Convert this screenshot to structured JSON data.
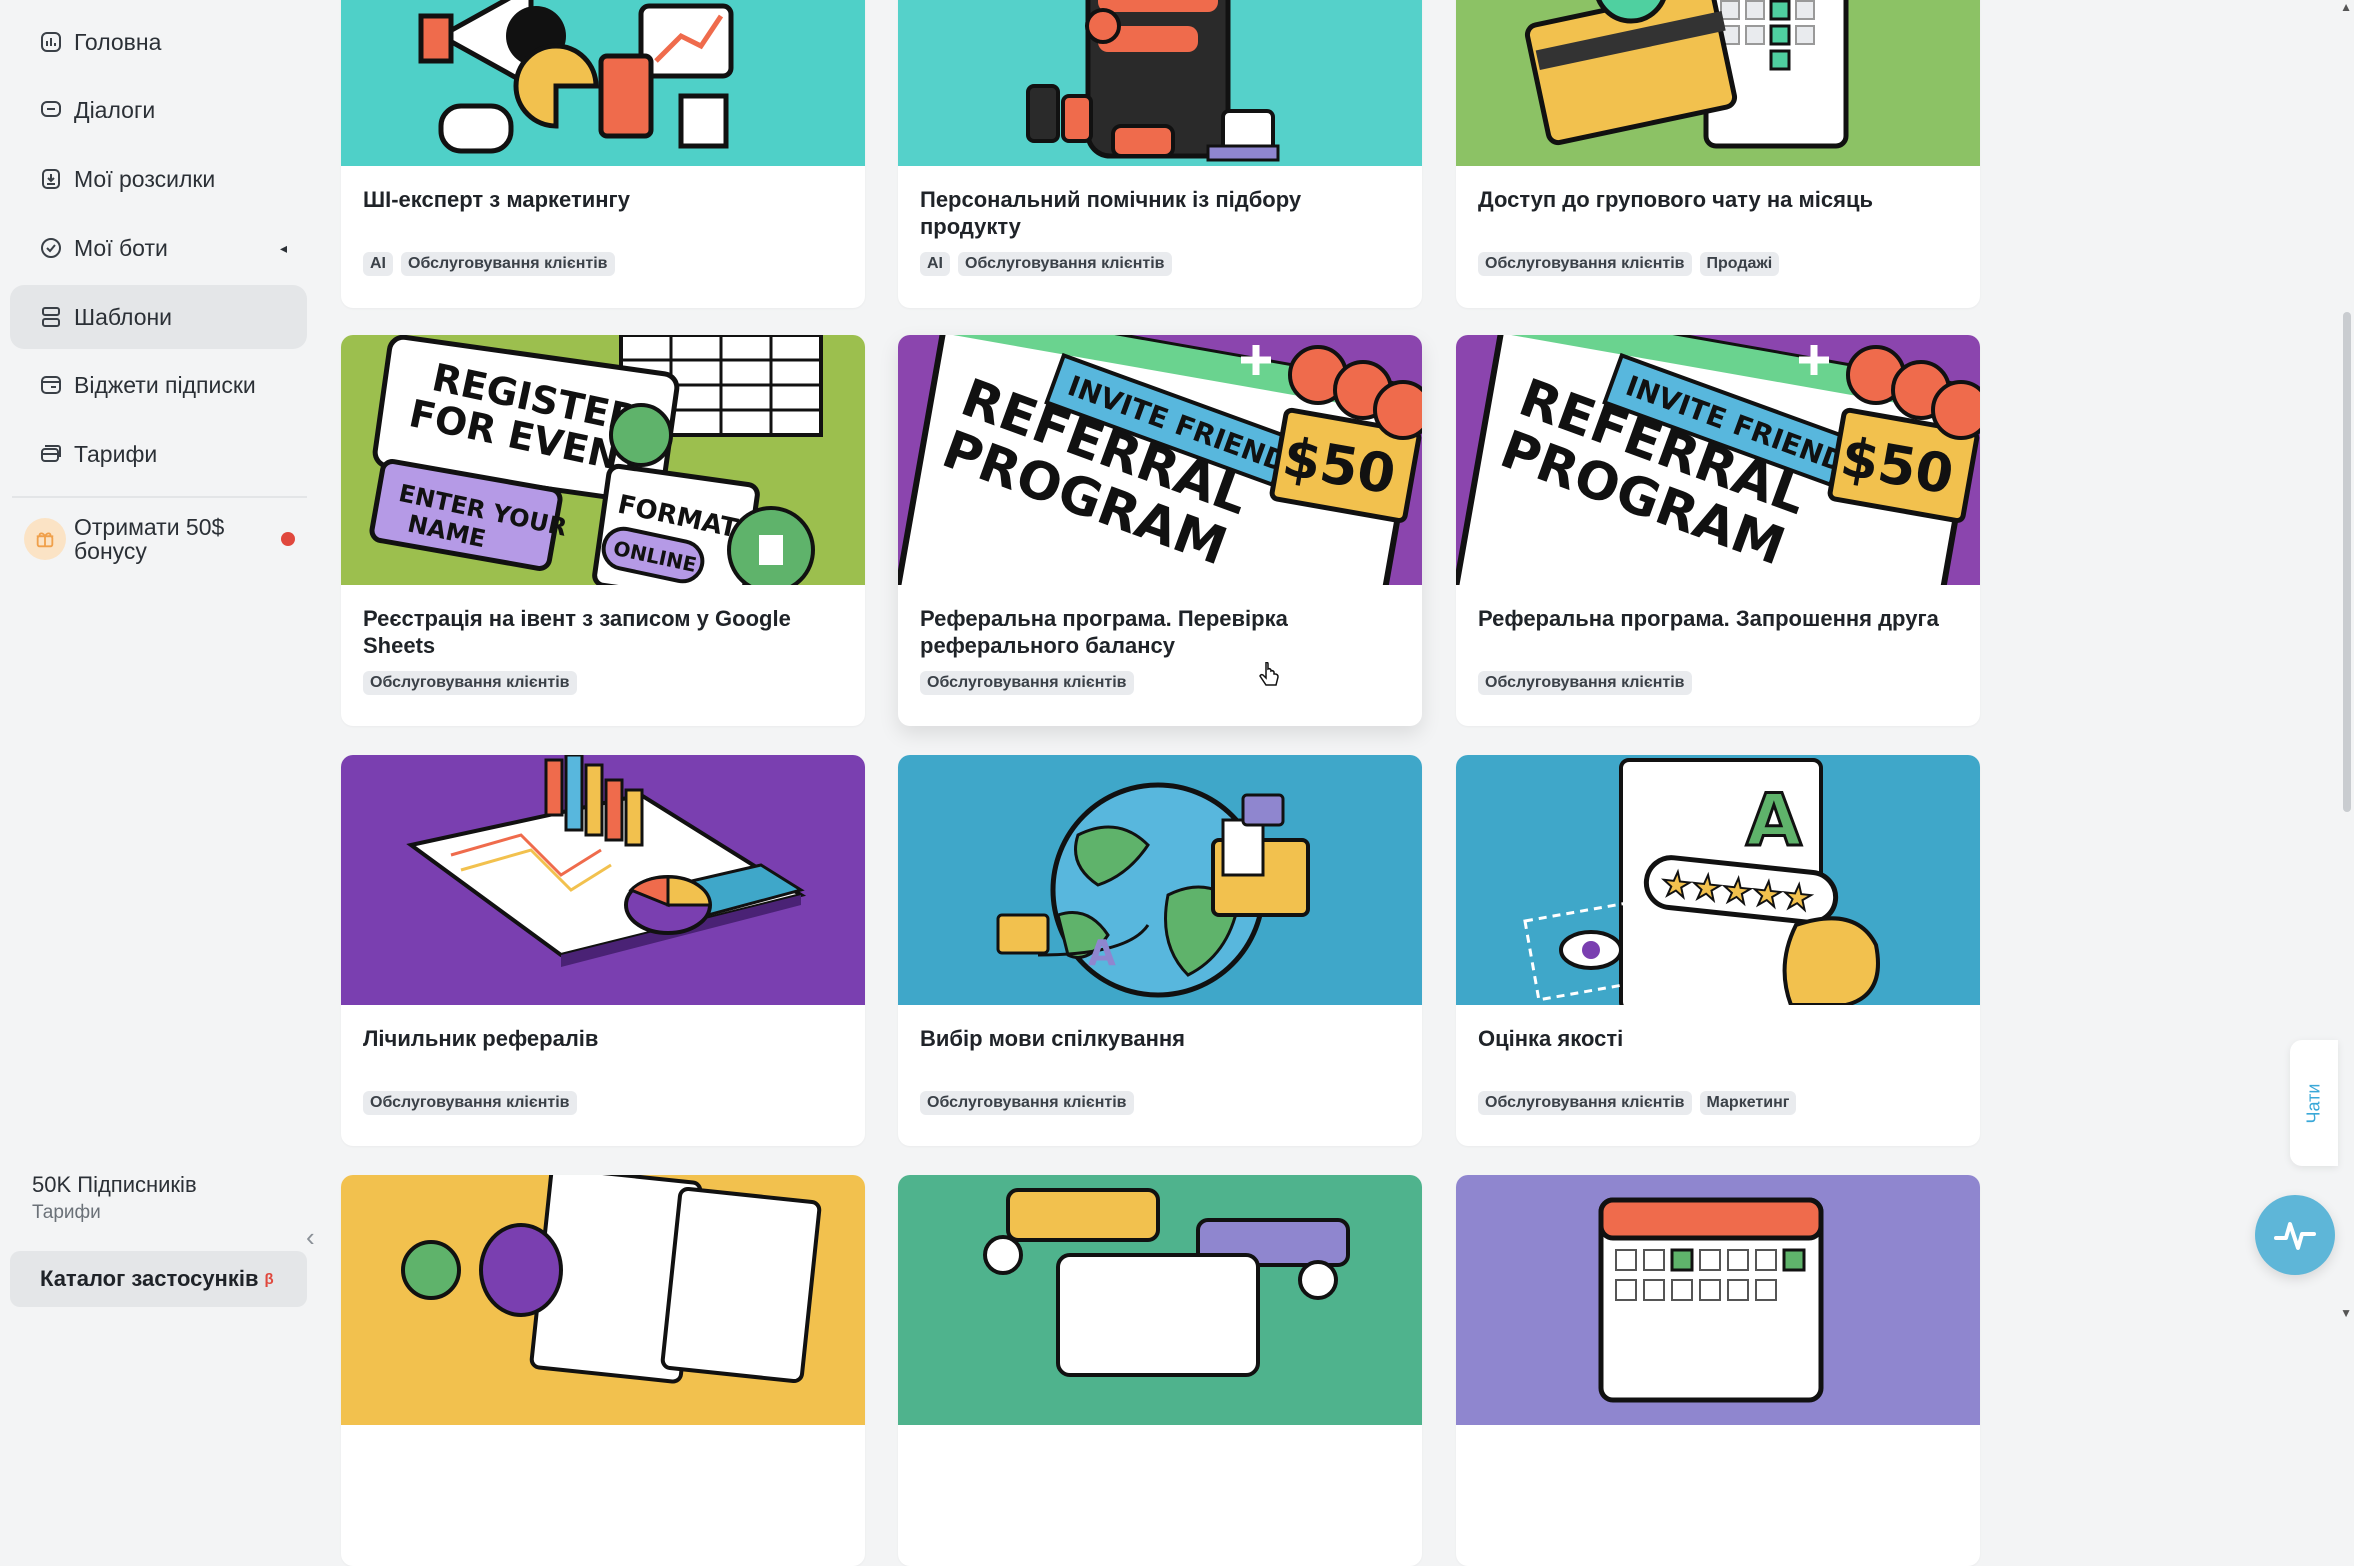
{
  "sidebar": {
    "items": [
      {
        "label": "Головна",
        "icon": "home-icon"
      },
      {
        "label": "Діалоги",
        "icon": "chat-icon"
      },
      {
        "label": "Мої розсилки",
        "icon": "broadcast-icon"
      },
      {
        "label": "Мої боти",
        "icon": "bot-icon",
        "arrow": "◂"
      },
      {
        "label": "Шаблони",
        "icon": "templates-icon",
        "active": true
      },
      {
        "label": "Віджети підписки",
        "icon": "widget-icon"
      },
      {
        "label": "Тарифи",
        "icon": "tariffs-icon"
      }
    ],
    "bonus": {
      "label": "Отримати 50$ бонусу",
      "icon": "gift-icon"
    },
    "subscribers": "50K Підписників",
    "subscribers_sub": "Тарифи",
    "catalog": "Каталог застосунків",
    "catalog_badge": "β",
    "collapse": "‹"
  },
  "cards": [
    {
      "title": "ШІ-експерт з маркетингу",
      "tags": [
        "AI",
        "Обслуговування клієнтів"
      ],
      "bg": "#4fd0c8"
    },
    {
      "title": "Персональний помічник із підбору продукту",
      "tags": [
        "AI",
        "Обслуговування клієнтів"
      ],
      "bg": "#55d1ca"
    },
    {
      "title": "Доступ до групового чату на місяць",
      "tags": [
        "Обслуговування клієнтів",
        "Продажі"
      ],
      "bg": "#8cc265"
    },
    {
      "title": "Реєстрація на івент з записом у Google Sheets",
      "tags": [
        "Обслуговування клієнтів"
      ],
      "bg": "#9cbf4e",
      "art": {
        "line1": "REGISTER",
        "line2": "FOR EVENT",
        "enter1": "ENTER YOUR",
        "enter2": "NAME",
        "format": "FORMAT:",
        "online": "ONLINE"
      }
    },
    {
      "title": "Реферальна програма. Перевірка реферального балансу",
      "tags": [
        "Обслуговування клієнтів"
      ],
      "bg": "#8b45ae",
      "art": {
        "invite": "INVITE FRIENDS",
        "ref1": "REFERRAL",
        "ref2": "PROGRAM",
        "amount": "$50"
      }
    },
    {
      "title": "Реферальна програма. Запрошення друга",
      "tags": [
        "Обслуговування клієнтів"
      ],
      "bg": "#8b45ae",
      "art": {
        "invite": "INVITE FRIENDS",
        "ref1": "REFERRAL",
        "ref2": "PROGRAM",
        "amount": "$50"
      }
    },
    {
      "title": "Лічильник рефералів",
      "tags": [
        "Обслуговування клієнтів"
      ],
      "bg": "#7a3fb0"
    },
    {
      "title": "Вибір мови спілкування",
      "tags": [
        "Обслуговування клієнтів"
      ],
      "bg": "#3fa7c9"
    },
    {
      "title": "Оцінка якості",
      "tags": [
        "Обслуговування клієнтів",
        "Маркетинг"
      ],
      "bg": "#3fa7c9",
      "art": {
        "letter": "A"
      }
    },
    {
      "title": "",
      "tags": [],
      "bg": "#f2c14e"
    },
    {
      "title": "",
      "tags": [],
      "bg": "#4fb38d"
    },
    {
      "title": "",
      "tags": [],
      "bg": "#8f86cf"
    }
  ],
  "chats_tab": "Чати",
  "colors": {
    "accent": "#3aa8d8",
    "bonus_dot": "#e0483d",
    "active_nav": "#e4e6e8"
  }
}
